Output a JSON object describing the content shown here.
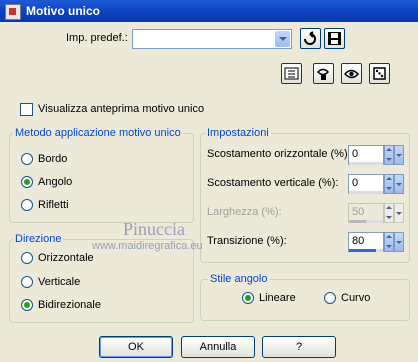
{
  "window": {
    "title": "Motivo unico"
  },
  "preset": {
    "label": "Imp. predef.:",
    "value": ""
  },
  "preview_checkbox": {
    "label": "Visualizza anteprima motivo unico",
    "checked": false
  },
  "method_group": {
    "title": "Metodo applicazione motivo unico",
    "options": [
      {
        "label": "Bordo",
        "selected": false
      },
      {
        "label": "Angolo",
        "selected": true
      },
      {
        "label": "Rifletti",
        "selected": false
      }
    ]
  },
  "direction_group": {
    "title": "Direzione",
    "options": [
      {
        "label": "Orizzontale",
        "selected": false
      },
      {
        "label": "Verticale",
        "selected": false
      },
      {
        "label": "Bidirezionale",
        "selected": true
      }
    ]
  },
  "settings_group": {
    "title": "Impostazioni",
    "fields": [
      {
        "label": "Scostamento orizzontale (%):",
        "value": "0",
        "level": 0,
        "disabled": false
      },
      {
        "label": "Scostamento verticale (%):",
        "value": "0",
        "level": 0,
        "disabled": false
      },
      {
        "label": "Larghezza (%):",
        "value": "50",
        "level": 0.5,
        "disabled": true
      },
      {
        "label": "Transizione (%):",
        "value": "80",
        "level": 0.8,
        "disabled": false
      }
    ]
  },
  "corner_style_group": {
    "title": "Stile angolo",
    "options": [
      {
        "label": "Lineare",
        "selected": true
      },
      {
        "label": "Curvo",
        "selected": false
      }
    ]
  },
  "watermark": {
    "name": "Pinuccia",
    "url": "www.maidiregrafica.eu"
  },
  "buttons": {
    "ok": "OK",
    "cancel": "Annulla",
    "help": "?"
  },
  "icons": {
    "preset_load": "load-preset-icon",
    "preset_save": "save-preset-icon",
    "toolbar": [
      "list-view-icon",
      "proof-icon",
      "eye-icon",
      "randomize-dice-icon"
    ]
  },
  "colors": {
    "accent": "#0046d5",
    "dialog_bg": "#ece9d8",
    "title_bar": "#0a3fc0"
  }
}
